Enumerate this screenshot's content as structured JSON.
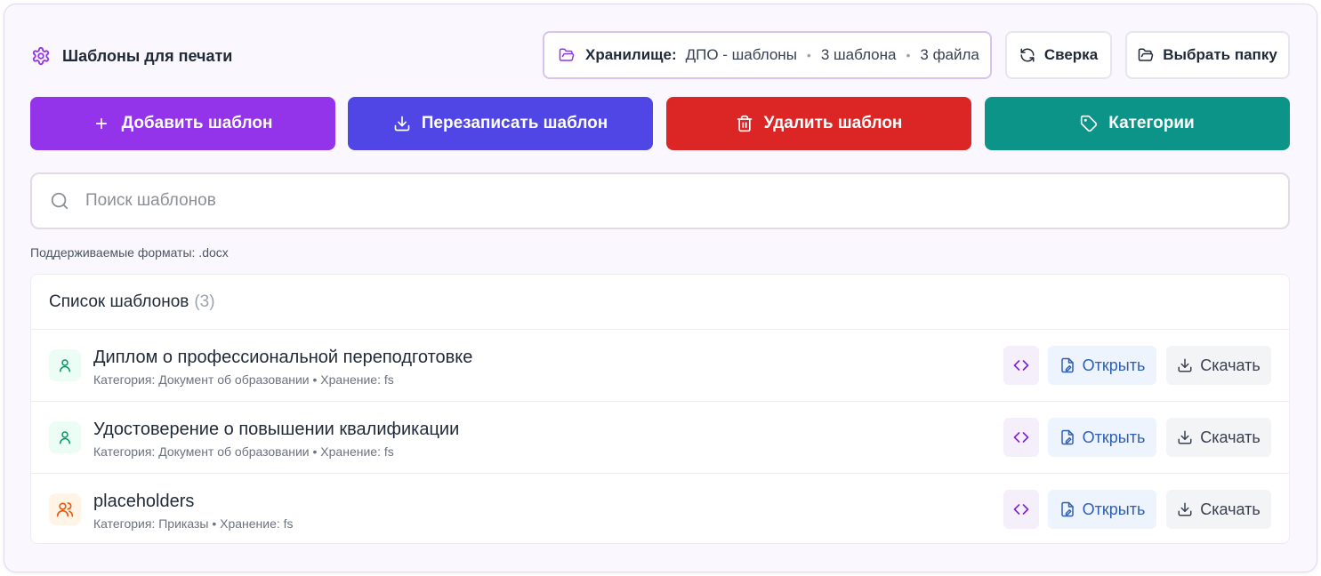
{
  "header": {
    "title": "Шаблоны для печати",
    "title_icon": "gear-icon",
    "storage": {
      "label": "Хранилище:",
      "name": "ДПО - шаблоны",
      "templates_count": "3 шаблона",
      "files_count": "3 файла",
      "icon": "folder-open-icon"
    },
    "sync_button": "Сверка",
    "choose_folder_button": "Выбрать папку"
  },
  "actions": {
    "add": {
      "label": "Добавить шаблон",
      "color": "#9333ea",
      "icon": "plus-icon"
    },
    "overwrite": {
      "label": "Перезаписать шаблон",
      "color": "#4f46e5",
      "icon": "download-icon"
    },
    "delete": {
      "label": "Удалить шаблон",
      "color": "#dc2626",
      "icon": "trash-icon"
    },
    "categories": {
      "label": "Категории",
      "color": "#0d9488",
      "icon": "tag-icon"
    }
  },
  "search": {
    "placeholder": "Поиск шаблонов",
    "value": ""
  },
  "formats_note": "Поддерживаемые форматы: .docx",
  "list": {
    "title": "Список шаблонов",
    "count": "(3)",
    "items": [
      {
        "name": "Диплом о профессиональной переподготовке",
        "meta": "Категория: Документ об образовании • Хранение: fs",
        "icon": "user-icon"
      },
      {
        "name": "Удостоверение о повышении квалификации",
        "meta": "Категория: Документ об образовании • Хранение: fs",
        "icon": "user-icon"
      },
      {
        "name": "placeholders",
        "meta": "Категория: Приказы • Хранение: fs",
        "icon": "users-icon"
      }
    ],
    "open_label": "Открыть",
    "download_label": "Скачать"
  }
}
